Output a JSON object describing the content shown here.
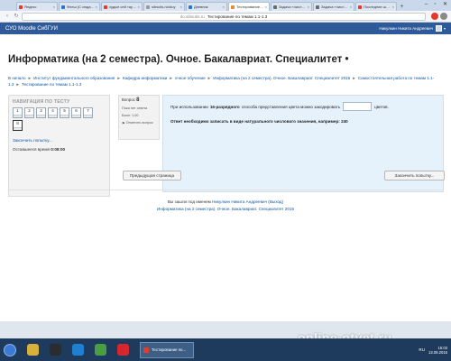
{
  "browser": {
    "tabs": [
      {
        "label": "Яндекс",
        "color": "#e6392b",
        "active": false
      },
      {
        "label": "Флеш (С сюда) | Кур",
        "color": "#2f70c8",
        "active": false
      },
      {
        "label": "худые сей тау ...",
        "color": "#e6392b",
        "active": false
      },
      {
        "label": "sibsutis.ru/stuy",
        "color": "#999999",
        "active": false
      },
      {
        "label": "Дневник",
        "color": "#2f70c8",
        "active": false
      },
      {
        "label": "Тестирование по",
        "color": "#e68a2b",
        "active": true
      },
      {
        "label": "Задача «числе 1...",
        "color": "#6a6a6a",
        "active": false
      },
      {
        "label": "Задача «числе 1...",
        "color": "#6a6a6a",
        "active": false
      },
      {
        "label": "Последние шар...",
        "color": "#e6392b",
        "active": false
      }
    ],
    "url_host": "do.sibsutis.ru",
    "page_title": "Тестирование по темам 1.1-1.3"
  },
  "navbar": {
    "brand": "СУО Moodle СибГУИ",
    "user": "Никулкин Никита Андреевич"
  },
  "course": {
    "title": "Информатика (на 2 семестра). Очное. Бакалавриат. Специалитет •"
  },
  "breadcrumbs": [
    "В начало",
    "Институт фундаментального образования",
    "Кафедра информатики",
    "очное обучение",
    "Информатика (на 2 семестра). Очное. Бакалавриат. Специалитет 2016",
    "Самостоятельная работа по темам 1.1-1.3",
    "Тестирование по темам 1.1-1.3"
  ],
  "quiz_nav": {
    "title": "НАВИГАЦИЯ ПО ТЕСТУ",
    "questions": [
      "1",
      "2",
      "3",
      "4",
      "5",
      "6",
      "7",
      "8"
    ],
    "current": "8",
    "finish_label": "Закончить попытку...",
    "time_left_label": "Оставшееся время",
    "time_left": "0:08:00"
  },
  "question_info": {
    "prefix": "Вопрос",
    "number": "8",
    "state": "Пока нет ответа",
    "mark": "Балл: 1,00",
    "flag_label": "Отметить вопрос"
  },
  "question": {
    "text_before": "При использовании",
    "bold_part": "16-разрядного",
    "text_middle": "способа представления цвета можно закодировать",
    "text_after": "цветов.",
    "answer_value": "",
    "hint": "Ответ необходимо записать в виде натурального числового значения, например: 240"
  },
  "buttons": {
    "prev": "Предыдущая страница",
    "next": "Закончить попытку..."
  },
  "footer": {
    "login_prefix": "Вы зашли под именем",
    "login_name": "Никулкин Никита Андреевич",
    "logout": "(Выход)",
    "course_link": "Информатика (на 2 семестра). Очное. Бакалавриат. Специалитет 2016"
  },
  "taskbar": {
    "icons": [
      {
        "name": "explorer-icon",
        "color": "#d7b23a"
      },
      {
        "name": "media-icon",
        "color": "#2c2c2c"
      },
      {
        "name": "store-icon",
        "color": "#1f7fd0"
      },
      {
        "name": "chrome-icon",
        "color": "#4a9e3f"
      },
      {
        "name": "opera-icon",
        "color": "#d8262e"
      }
    ],
    "active_task": "Тестирование по...",
    "lang": "RU",
    "clock_time": "15:03",
    "clock_date": "13.09.2016"
  },
  "watermark": "online-otvet.ru"
}
